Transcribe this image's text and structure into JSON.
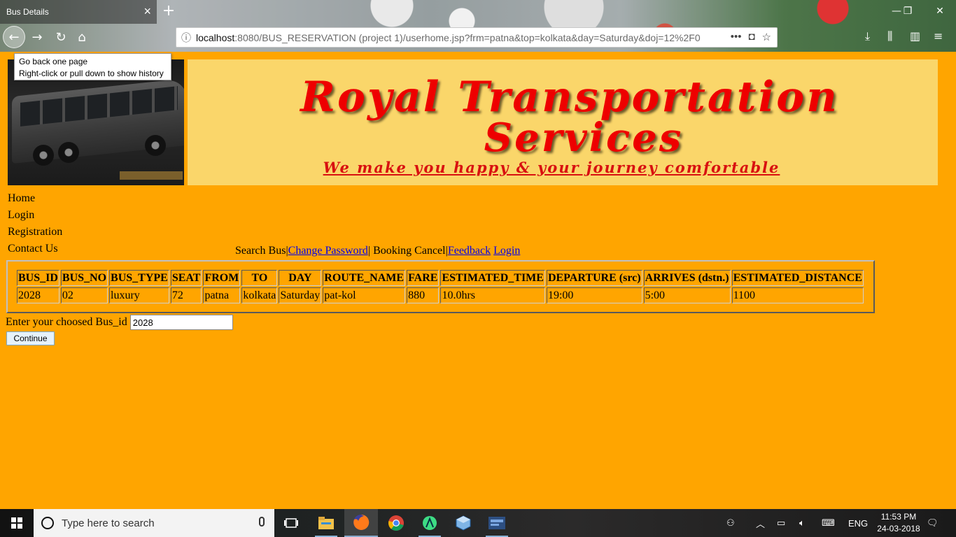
{
  "browser": {
    "tab_title": "Bus Details",
    "url_host": "localhost",
    "url_rest": ":8080/BUS_RESERVATION (project 1)/userhome.jsp?frm=patna&top=kolkata&day=Saturday&doj=12%2F0",
    "tooltip_line1": "Go back one page",
    "tooltip_line2": "Right-click or pull down to show history"
  },
  "banner": {
    "title_line1": "Royal Transportation",
    "title_line2": "Services",
    "tagline": "We make you happy & your journey comfortable"
  },
  "side_nav": [
    "Home",
    "Login",
    "Registration",
    "Contact Us"
  ],
  "top_menu": {
    "search_bus": "Search Bus",
    "change_password": "Change Password",
    "booking_cancel": "Booking Cancel",
    "feedback": "Feedback",
    "login": "Login",
    "separator": "|"
  },
  "bus_table": {
    "headers": [
      "BUS_ID",
      "BUS_NO",
      "BUS_TYPE",
      "SEAT",
      "FROM",
      "TO",
      "DAY",
      "ROUTE_NAME",
      "FARE",
      "ESTIMATED_TIME",
      "DEPARTURE (src)",
      "ARRIVES (dstn.)",
      "ESTIMATED_DISTANCE"
    ],
    "rows": [
      [
        "2028",
        "02",
        "luxury",
        "72",
        "patna",
        "kolkata",
        "Saturday",
        "pat-kol",
        "880",
        "10.0hrs",
        "19:00",
        "5:00",
        "1100"
      ]
    ]
  },
  "form": {
    "label": "Enter your choosed Bus_id",
    "bus_id_value": "2028",
    "continue_label": "Continue"
  },
  "taskbar": {
    "search_placeholder": "Type here to search",
    "language": "ENG",
    "time": "11:53 PM",
    "date": "24-03-2018"
  }
}
